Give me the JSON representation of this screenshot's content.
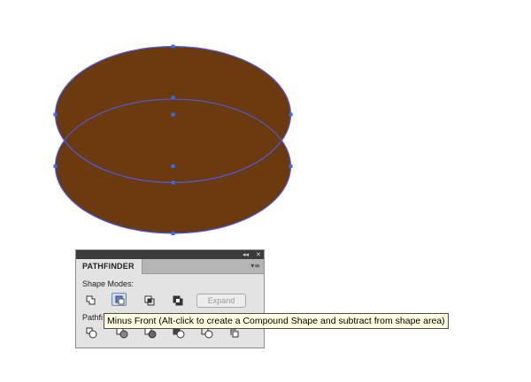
{
  "panel": {
    "tab_label": "PATHFINDER",
    "collapse_glyph": "◂◂",
    "close_glyph": "✕",
    "menu_glyph": "▾≡",
    "shape_modes_label": "Shape Modes:",
    "pathfinders_label_visible": "Pathfi",
    "expand_label": "Expand",
    "shape_mode_buttons": [
      "unite-icon",
      "minus-front-icon",
      "intersect-icon",
      "exclude-icon"
    ],
    "pathfinder_buttons": [
      "divide-icon",
      "trim-icon",
      "merge-icon",
      "crop-icon",
      "outline-icon",
      "minus-back-icon"
    ]
  },
  "tooltip": {
    "text": "Minus Front (Alt-click to create a Compound Shape and subtract from shape area)"
  },
  "artwork": {
    "fill_color": "#6b3a0f",
    "path_color": "#4a5ef0",
    "anchor_color": "#3a6af5"
  }
}
